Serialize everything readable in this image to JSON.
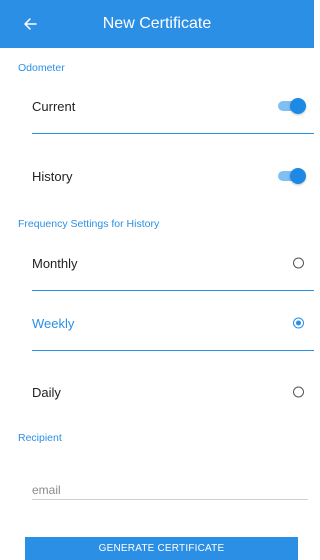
{
  "appbar": {
    "title": "New Certificate",
    "back_icon": "arrow-left-icon",
    "color": "#2b8fe6"
  },
  "odometer": {
    "section_label": "Odometer",
    "current": {
      "label": "Current",
      "enabled": true
    },
    "history": {
      "label": "History",
      "enabled": true
    }
  },
  "frequency": {
    "section_label": "Frequency Settings for History",
    "options": [
      {
        "label": "Monthly",
        "selected": false
      },
      {
        "label": "Weekly",
        "selected": true
      },
      {
        "label": "Daily",
        "selected": false
      }
    ]
  },
  "recipient": {
    "section_label": "Recipient",
    "email_placeholder": "email",
    "email_value": ""
  },
  "actions": {
    "generate_label": "GENERATE CERTIFICATE"
  }
}
